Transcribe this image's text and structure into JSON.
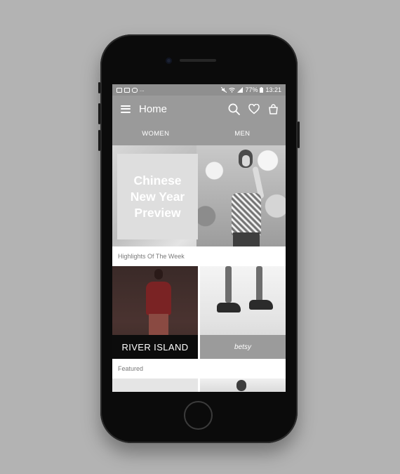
{
  "status_bar": {
    "battery": "77%",
    "time": "13:21",
    "notification_more": "..."
  },
  "app_bar": {
    "title": "Home"
  },
  "tabs": [
    {
      "label": "WOMEN",
      "active": true
    },
    {
      "label": "MEN",
      "active": false
    }
  ],
  "hero": {
    "headline": "Chinese\nNew Year\nPreview"
  },
  "highlights": {
    "label": "Highlights Of The Week",
    "cards": [
      {
        "brand": "RIVER ISLAND"
      },
      {
        "brand": "betsy"
      }
    ]
  },
  "featured": {
    "label": "Featured"
  },
  "colors": {
    "background": "#b3b3b3",
    "app_bar": "#9a9a9a",
    "phone_body": "#0b0b0b",
    "river_island_bar": "#0c0c0c",
    "betsy_bar": "#9b9b9b"
  },
  "icons": [
    "menu-icon",
    "search-icon",
    "heart-icon",
    "bag-icon"
  ]
}
